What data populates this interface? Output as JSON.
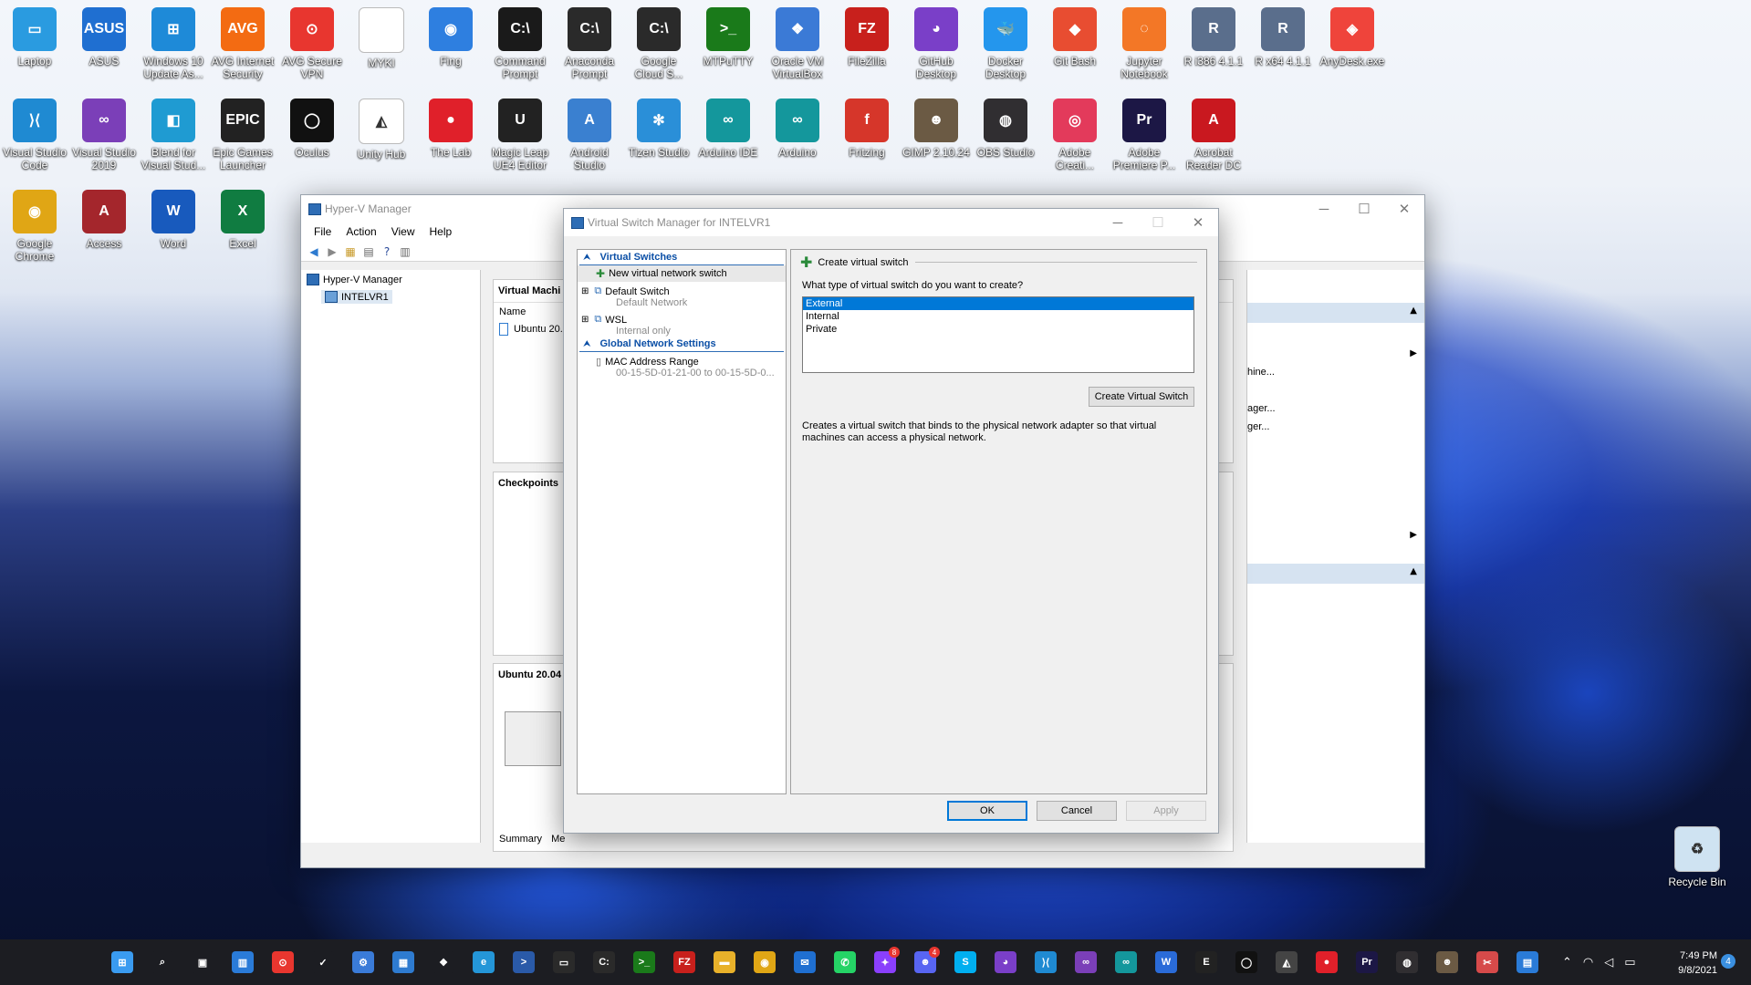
{
  "desktop_icons": [
    {
      "label": "Laptop",
      "icon": "laptop-icon",
      "color": "#2a9be0",
      "glyph": "▭"
    },
    {
      "label": "ASUS",
      "icon": "asus-icon",
      "color": "#1f6fd1",
      "glyph": "ASUS"
    },
    {
      "label": "Windows 10\nUpdate As...",
      "icon": "windows-update-icon",
      "color": "#1e8ad8",
      "glyph": "⊞"
    },
    {
      "label": "AVG Internet\nSecurity",
      "icon": "avg-icon",
      "color": "#f36b12",
      "glyph": "AVG"
    },
    {
      "label": "AVG Secure\nVPN",
      "icon": "avg-vpn-icon",
      "color": "#e8362f",
      "glyph": "⊙"
    },
    {
      "label": "MYKI",
      "icon": "myki-file-icon",
      "color": "#ffffff",
      "glyph": ""
    },
    {
      "label": "Fing",
      "icon": "fing-icon",
      "color": "#2e7fe0",
      "glyph": "◉"
    },
    {
      "label": "Command\nPrompt",
      "icon": "cmd-icon",
      "color": "#1a1a1a",
      "glyph": "C:\\"
    },
    {
      "label": "Anaconda\nPrompt",
      "icon": "anaconda-prompt-icon",
      "color": "#2a2a2a",
      "glyph": "C:\\"
    },
    {
      "label": "Google\nCloud S...",
      "icon": "gcloud-sdk-icon",
      "color": "#2a2a2a",
      "glyph": "C:\\"
    },
    {
      "label": "MTPuTTY",
      "icon": "mtputty-icon",
      "color": "#1a7a1a",
      "glyph": ">_"
    },
    {
      "label": "Oracle VM\nVirtualBox",
      "icon": "virtualbox-icon",
      "color": "#3b7ad6",
      "glyph": "❖"
    },
    {
      "label": "FileZilla",
      "icon": "filezilla-icon",
      "color": "#c8201c",
      "glyph": "FZ"
    },
    {
      "label": "GitHub\nDesktop",
      "icon": "github-desktop-icon",
      "color": "#7a3fc8",
      "glyph": "◕"
    },
    {
      "label": "Docker\nDesktop",
      "icon": "docker-icon",
      "color": "#2496ed",
      "glyph": "🐳"
    },
    {
      "label": "Git Bash",
      "icon": "git-bash-icon",
      "color": "#e84d31",
      "glyph": "◆"
    },
    {
      "label": "Jupyter\nNotebook",
      "icon": "jupyter-icon",
      "color": "#f37726",
      "glyph": "◌"
    },
    {
      "label": "R i386 4.1.1",
      "icon": "r-icon",
      "color": "#5a6e8c",
      "glyph": "R"
    },
    {
      "label": "R x64 4.1.1",
      "icon": "r-x64-icon",
      "color": "#5a6e8c",
      "glyph": "R"
    },
    {
      "label": "AnyDesk.exe",
      "icon": "anydesk-icon",
      "color": "#ef443b",
      "glyph": "◈"
    },
    {
      "label": "Visual Studio\nCode",
      "icon": "vscode-icon",
      "color": "#1f8ad2",
      "glyph": "⟩⟨"
    },
    {
      "label": "Visual Studio\n2019",
      "icon": "visual-studio-icon",
      "color": "#7b3fb8",
      "glyph": "∞"
    },
    {
      "label": "Blend for\nVisual Stud...",
      "icon": "blend-icon",
      "color": "#1f9bd2",
      "glyph": "◧"
    },
    {
      "label": "Epic Games\nLauncher",
      "icon": "epic-games-icon",
      "color": "#222222",
      "glyph": "EPIC"
    },
    {
      "label": "Oculus",
      "icon": "oculus-icon",
      "color": "#111111",
      "glyph": "◯"
    },
    {
      "label": "Unity Hub",
      "icon": "unity-hub-icon",
      "color": "#ffffff",
      "glyph": "◭"
    },
    {
      "label": "The Lab",
      "icon": "the-lab-icon",
      "color": "#e0202a",
      "glyph": "●"
    },
    {
      "label": "Magic Leap\nUE4 Editor",
      "icon": "unreal-icon",
      "color": "#222222",
      "glyph": "U"
    },
    {
      "label": "Android\nStudio",
      "icon": "android-studio-icon",
      "color": "#3a80d0",
      "glyph": "A"
    },
    {
      "label": "Tizen Studio",
      "icon": "tizen-icon",
      "color": "#2a8fd8",
      "glyph": "✻"
    },
    {
      "label": "Arduino IDE",
      "icon": "arduino-ide-icon",
      "color": "#14979c",
      "glyph": "∞"
    },
    {
      "label": "Arduino",
      "icon": "arduino-icon",
      "color": "#14979c",
      "glyph": "∞"
    },
    {
      "label": "Fritzing",
      "icon": "fritzing-icon",
      "color": "#d6362a",
      "glyph": "f"
    },
    {
      "label": "GIMP 2.10.24",
      "icon": "gimp-icon",
      "color": "#6b5a44",
      "glyph": "☻"
    },
    {
      "label": "OBS Studio",
      "icon": "obs-icon",
      "color": "#302e31",
      "glyph": "◍"
    },
    {
      "label": "Adobe\nCreati...",
      "icon": "adobe-cc-icon",
      "color": "#e33a5b",
      "glyph": "◎"
    },
    {
      "label": "Adobe\nPremiere P...",
      "icon": "premiere-icon",
      "color": "#1c1745",
      "glyph": "Pr"
    },
    {
      "label": "Acrobat\nReader DC",
      "icon": "acrobat-icon",
      "color": "#c9181f",
      "glyph": "A"
    },
    {
      "label": "Google\nChrome",
      "icon": "chrome-icon",
      "color": "#e0a615",
      "glyph": "◉"
    },
    {
      "label": "Access",
      "icon": "access-icon",
      "color": "#a4262c",
      "glyph": "A"
    },
    {
      "label": "Word",
      "icon": "word-icon",
      "color": "#185abd",
      "glyph": "W"
    },
    {
      "label": "Excel",
      "icon": "excel-icon",
      "color": "#107c41",
      "glyph": "X"
    },
    {
      "label": "Recycle Bin",
      "icon": "recycle-bin-icon",
      "color": "#cfe3f2",
      "glyph": "♻"
    }
  ],
  "hyperv": {
    "title": "Hyper-V Manager",
    "menu": [
      "File",
      "Action",
      "View",
      "Help"
    ],
    "tree_root": "Hyper-V Manager",
    "tree_server": "INTELVR1",
    "vm_panel_title": "Virtual Machi",
    "vm_col_name": "Name",
    "vm_row": "Ubuntu 20.0",
    "checkpoints_title": "Checkpoints",
    "details_title": "Ubuntu 20.04",
    "tab_summary": "Summary",
    "tab_memory": "Me",
    "actions_frag": [
      "hine...",
      "ager...",
      "ger..."
    ]
  },
  "vsm": {
    "title": "Virtual Switch Manager for INTELVR1",
    "sec_virtual_switches": "Virtual Switches",
    "new_switch": "New virtual network switch",
    "default_switch": "Default Switch",
    "default_switch_sub": "Default Network",
    "wsl": "WSL",
    "wsl_sub": "Internal only",
    "sec_global": "Global Network Settings",
    "mac_range": "MAC Address Range",
    "mac_range_val": "00-15-5D-01-21-00 to 00-15-5D-0...",
    "create_header": "Create virtual switch",
    "question": "What type of virtual switch do you want to create?",
    "types": [
      "External",
      "Internal",
      "Private"
    ],
    "selected_type": "External",
    "create_btn": "Create Virtual Switch",
    "description": "Creates a virtual switch that binds to the physical network adapter so that virtual machines can access a physical network.",
    "ok": "OK",
    "cancel": "Cancel",
    "apply": "Apply"
  },
  "taskbar": {
    "time": "7:49 PM",
    "date": "9/8/2021",
    "messenger_badge": "8",
    "discord_badge": "4",
    "notification_count": "4",
    "apps": [
      {
        "icon": "start-icon",
        "color": "#3a9bf0",
        "glyph": "⊞"
      },
      {
        "icon": "search-icon",
        "color": "#1c1d22",
        "glyph": "⌕"
      },
      {
        "icon": "task-view-icon",
        "color": "#1c1d22",
        "glyph": "▣"
      },
      {
        "icon": "widgets-icon",
        "color": "#2a7bd8",
        "glyph": "▥"
      },
      {
        "icon": "avg-vpn-icon",
        "color": "#e8362f",
        "glyph": "⊙"
      },
      {
        "icon": "vivaldi-icon",
        "color": "#1c1d22",
        "glyph": "✓"
      },
      {
        "icon": "settings-icon",
        "color": "#3a7bd8",
        "glyph": "⚙"
      },
      {
        "icon": "hyperv-manager-icon",
        "color": "#2e7bd0",
        "glyph": "▦"
      },
      {
        "icon": "virtualbox-icon",
        "color": "#1c1d22",
        "glyph": "❖"
      },
      {
        "icon": "edge-icon",
        "color": "#2496d8",
        "glyph": "e"
      },
      {
        "icon": "powershell-icon",
        "color": "#2a5aa8",
        "glyph": ">"
      },
      {
        "icon": "terminal-icon",
        "color": "#2a2a2a",
        "glyph": "▭"
      },
      {
        "icon": "cmd-icon",
        "color": "#2a2a2a",
        "glyph": "C:"
      },
      {
        "icon": "mtputty-icon",
        "color": "#1a7a1a",
        "glyph": ">_"
      },
      {
        "icon": "filezilla-icon",
        "color": "#c8201c",
        "glyph": "FZ"
      },
      {
        "icon": "file-explorer-icon",
        "color": "#e8b12a",
        "glyph": "▬"
      },
      {
        "icon": "chrome-icon",
        "color": "#e0a615",
        "glyph": "◉"
      },
      {
        "icon": "outlook-icon",
        "color": "#1f6fd1",
        "glyph": "✉"
      },
      {
        "icon": "whatsapp-icon",
        "color": "#25d366",
        "glyph": "✆"
      },
      {
        "icon": "messenger-icon",
        "color": "#8a3ffc",
        "glyph": "✦"
      },
      {
        "icon": "discord-icon",
        "color": "#5865f2",
        "glyph": "☻"
      },
      {
        "icon": "skype-icon",
        "color": "#00aff0",
        "glyph": "S"
      },
      {
        "icon": "github-desktop-icon",
        "color": "#7a3fc8",
        "glyph": "◕"
      },
      {
        "icon": "vscode-icon",
        "color": "#1f8ad2",
        "glyph": "⟩⟨"
      },
      {
        "icon": "visual-studio-icon",
        "color": "#7b3fb8",
        "glyph": "∞"
      },
      {
        "icon": "arduino-icon",
        "color": "#14979c",
        "glyph": "∞"
      },
      {
        "icon": "wordpad-icon",
        "color": "#2a6bd8",
        "glyph": "W"
      },
      {
        "icon": "epic-games-icon",
        "color": "#222222",
        "glyph": "E"
      },
      {
        "icon": "oculus-icon",
        "color": "#111111",
        "glyph": "◯"
      },
      {
        "icon": "unity-hub-icon",
        "color": "#444444",
        "glyph": "◭"
      },
      {
        "icon": "the-lab-icon",
        "color": "#e0202a",
        "glyph": "●"
      },
      {
        "icon": "premiere-icon",
        "color": "#1c1745",
        "glyph": "Pr"
      },
      {
        "icon": "obs-icon",
        "color": "#302e31",
        "glyph": "◍"
      },
      {
        "icon": "gimp-icon",
        "color": "#6b5a44",
        "glyph": "☻"
      },
      {
        "icon": "snipping-tool-icon",
        "color": "#d64a4a",
        "glyph": "✂"
      },
      {
        "icon": "network-adapter-icon",
        "color": "#2a7bd8",
        "glyph": "▤"
      }
    ]
  }
}
